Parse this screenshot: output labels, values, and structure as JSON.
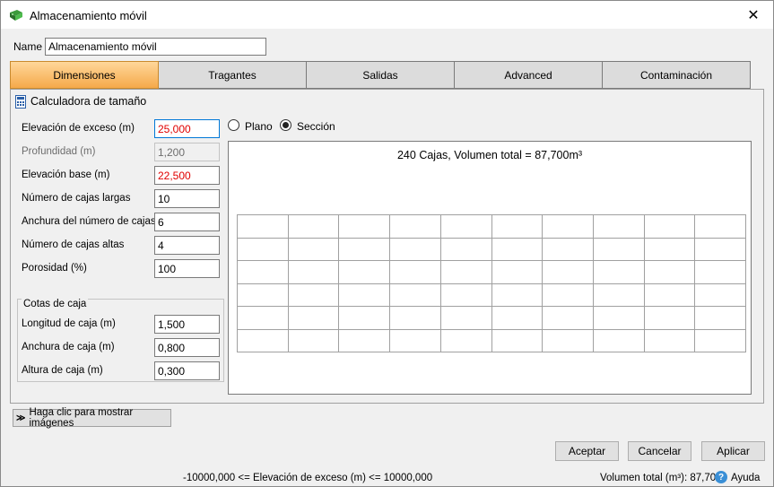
{
  "window": {
    "title": "Almacenamiento móvil"
  },
  "name_row": {
    "label": "Name",
    "value": "Almacenamiento móvil"
  },
  "tabs": [
    {
      "label": "Dimensiones",
      "active": true
    },
    {
      "label": "Tragantes",
      "active": false
    },
    {
      "label": "Salidas",
      "active": false
    },
    {
      "label": "Advanced",
      "active": false
    },
    {
      "label": "Contaminación",
      "active": false
    }
  ],
  "calculator": {
    "title": "Calculadora de tamaño",
    "rows": [
      {
        "label": "Elevación de exceso (m)",
        "value": "25,000"
      },
      {
        "label": "Profundidad (m)",
        "value": "1,200"
      },
      {
        "label": "Elevación base (m)",
        "value": "22,500"
      },
      {
        "label": "Número de cajas largas",
        "value": "10"
      },
      {
        "label": "Anchura del número de cajas",
        "value": "6"
      },
      {
        "label": "Número de cajas altas",
        "value": "4"
      },
      {
        "label": "Porosidad (%)",
        "value": "100"
      }
    ],
    "box_dims": {
      "legend": "Cotas de caja",
      "rows": [
        {
          "label": "Longitud de caja (m)",
          "value": "1,500"
        },
        {
          "label": "Anchura de caja (m)",
          "value": "0,800"
        },
        {
          "label": "Altura de caja (m)",
          "value": "0,300"
        }
      ]
    }
  },
  "view_mode": {
    "plano_label": "Plano",
    "seccion_label": "Sección",
    "selected": "Sección"
  },
  "preview": {
    "caption": "240 Cajas, Volumen total = 87,700m³",
    "columns": 10,
    "rows": 6
  },
  "show_images_button": "Haga clic para mostrar imágenes",
  "buttons": {
    "accept": "Aceptar",
    "cancel": "Cancelar",
    "apply": "Aplicar"
  },
  "status": {
    "constraint": "-10000,000 <= Elevación de exceso (m) <= 10000,000",
    "total_volume": "Volumen total (m³): 87,700",
    "help": "Ayuda"
  },
  "colors": {
    "active_tab": "#f5a94a",
    "error_text": "#e00000",
    "focus_border": "#0078d7",
    "help_icon": "#3a8fd6"
  },
  "icons": [
    "app-icon",
    "close-icon",
    "calculator-icon",
    "chevron-double-down-icon",
    "help-icon"
  ]
}
